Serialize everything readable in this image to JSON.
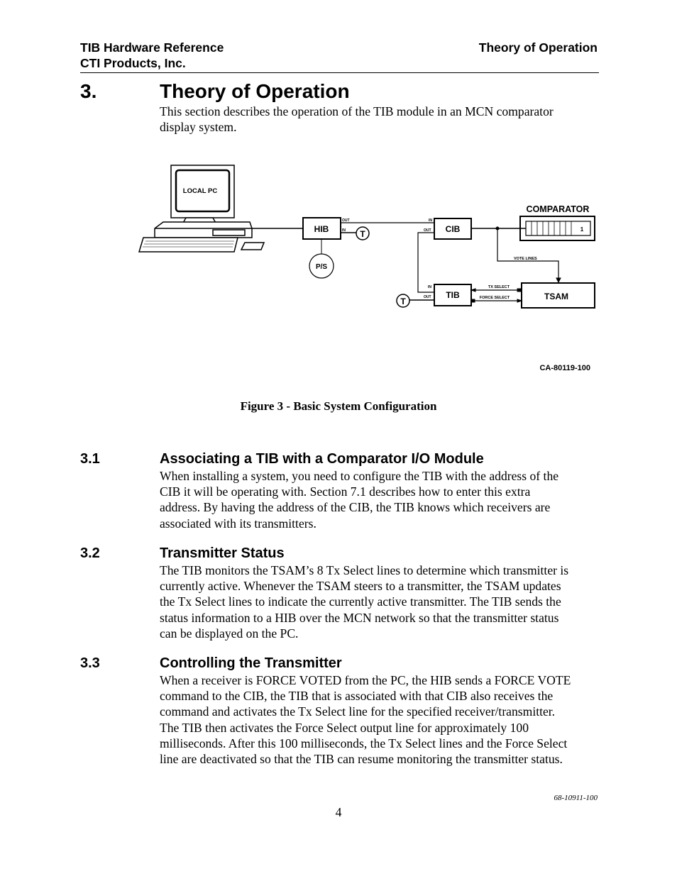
{
  "header": {
    "title": "TIB Hardware Reference",
    "company": "CTI Products, Inc.",
    "section": "Theory of Operation"
  },
  "chapter": {
    "number": "3.",
    "title": "Theory of Operation",
    "intro": [
      "This section describes the operation of the TIB module in an MCN comparator",
      "display system."
    ]
  },
  "figure": {
    "labels": {
      "local_pc": "LOCAL PC",
      "hib": "HIB",
      "ps": "P/S",
      "cib": "CIB",
      "tib": "TIB",
      "tsam": "TSAM",
      "comparator": "COMPARATOR",
      "comparator_slot": "1",
      "t": "T",
      "in": "IN",
      "out": "OUT",
      "vote_lines": "VOTE LINES",
      "tx_select": "TX SELECT",
      "force_select": "FORCE SELECT",
      "drawing_number": "CA-80119-100"
    },
    "caption": "Figure 3 - Basic System Configuration"
  },
  "sections": [
    {
      "number": "3.1",
      "title": "Associating a TIB with a Comparator I/O Module",
      "lines": [
        "When installing a system, you need to configure the TIB with the address of the",
        "CIB it will be operating with.  Section 7.1 describes how to enter this extra",
        "address.  By having the address of the CIB, the TIB knows which receivers are",
        "associated with its transmitters."
      ]
    },
    {
      "number": "3.2",
      "title": "Transmitter Status",
      "lines": [
        "The TIB monitors the TSAM’s 8 Tx Select lines to determine which transmitter is",
        "currently active.  Whenever the TSAM steers to a transmitter, the TSAM updates",
        "the Tx Select lines to indicate the currently active transmitter.  The TIB sends the",
        "status information to a HIB over the MCN network so that the transmitter status",
        "can be displayed on the PC."
      ]
    },
    {
      "number": "3.3",
      "title": "Controlling the Transmitter",
      "lines": [
        "When a receiver is FORCE VOTED from the PC, the HIB sends a FORCE VOTE",
        "command to the CIB, the TIB that is associated with that CIB also receives the",
        "command and activates the Tx Select line for the specified receiver/transmitter.",
        "The TIB then activates the Force Select output line for approximately 100",
        "milliseconds.  After this 100 milliseconds, the Tx Select lines and the Force Select",
        "line are deactivated so that the TIB can resume monitoring the transmitter status."
      ]
    }
  ],
  "footer": {
    "doc_number": "68-10911-100",
    "page": "4"
  }
}
